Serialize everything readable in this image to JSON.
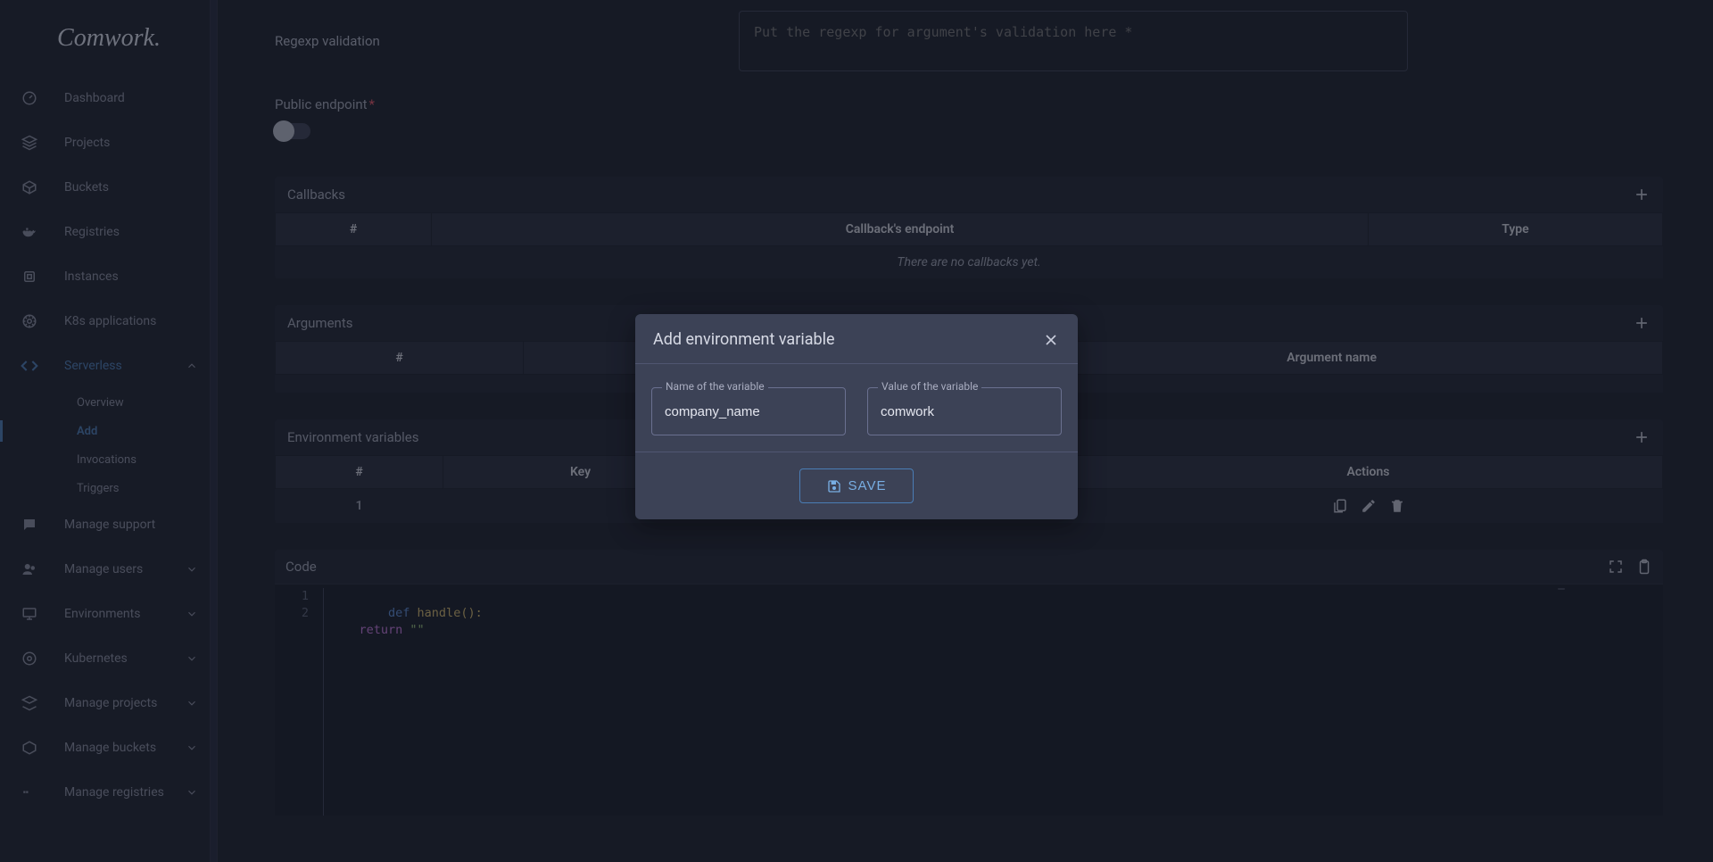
{
  "logo": "Comwork.",
  "sidebar": {
    "items": [
      {
        "label": "Dashboard"
      },
      {
        "label": "Projects"
      },
      {
        "label": "Buckets"
      },
      {
        "label": "Registries"
      },
      {
        "label": "Instances"
      },
      {
        "label": "K8s applications"
      },
      {
        "label": "Serverless",
        "active": true,
        "expanded": true,
        "children": [
          {
            "label": "Overview"
          },
          {
            "label": "Add",
            "active": true
          },
          {
            "label": "Invocations"
          },
          {
            "label": "Triggers"
          }
        ]
      },
      {
        "label": "Manage support"
      },
      {
        "label": "Manage users",
        "expandable": true
      },
      {
        "label": "Environments",
        "expandable": true
      },
      {
        "label": "Kubernetes",
        "expandable": true
      },
      {
        "label": "Manage projects",
        "expandable": true
      },
      {
        "label": "Manage buckets",
        "expandable": true
      },
      {
        "label": "Manage registries",
        "expandable": true
      }
    ]
  },
  "form": {
    "regexp_label": "Regexp validation",
    "regexp_placeholder": "Put the regexp for argument's validation here *",
    "public_endpoint_label": "Public endpoint",
    "public_endpoint_on": false
  },
  "callbacks": {
    "header": "Callbacks",
    "cols": {
      "idx": "#",
      "endpoint": "Callback's endpoint",
      "type": "Type"
    },
    "empty": "There are no callbacks yet."
  },
  "arguments": {
    "header": "Arguments",
    "cols": {
      "idx": "#",
      "name": "Argument name"
    },
    "empty_hidden": ""
  },
  "envvars": {
    "header": "Environment variables",
    "cols": {
      "idx": "#",
      "key": "Key",
      "actions": "Actions"
    },
    "rows": [
      {
        "idx": "1"
      }
    ]
  },
  "code": {
    "header": "Code",
    "lines": {
      "n1": "1",
      "n2": "2",
      "l1": {
        "def": "def",
        "name": " handle",
        "paren": "():"
      },
      "l2": {
        "indent": "    ",
        "ret": "return",
        "str": " \"\""
      }
    }
  },
  "modal": {
    "title": "Add environment variable",
    "name_label": "Name of the variable",
    "name_value": "company_name",
    "value_label": "Value of the variable",
    "value_value": "comwork",
    "save": "SAVE"
  }
}
